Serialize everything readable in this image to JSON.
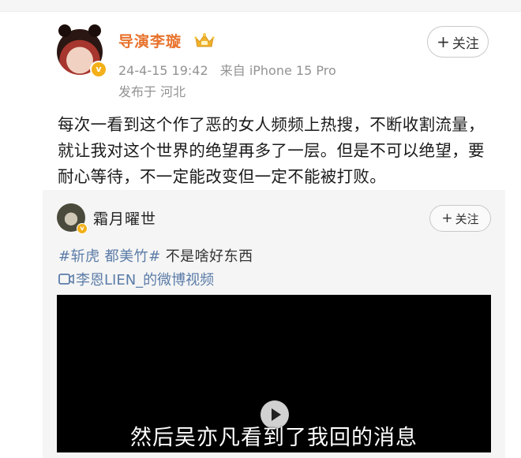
{
  "post": {
    "author_name": "导演李璇",
    "timestamp": "24-4-15 19:42",
    "source": "来自 iPhone 15 Pro",
    "location": "发布于 河北",
    "follow_label": "关注",
    "text": "每次一看到这个作了恶的女人频频上热搜，不断收割流量，就让我对这个世界的绝望再多了一层。但是不可以绝望，要耐心等待，不一定能改变但一定不能被打败。"
  },
  "repost": {
    "author_name": "霜月曜世",
    "follow_label": "关注",
    "tags": [
      "#斩虎",
      "都美竹#"
    ],
    "tag_plain": "不是啥好东西",
    "video_link": "李恩LIEN_的微博视频",
    "video_subtitle": "然后吴亦凡看到了我回的消息"
  },
  "icons": {
    "verified": "verified-badge-icon",
    "crown": "crown-icon",
    "video": "video-icon",
    "play": "play-icon",
    "plus": "plus-icon"
  },
  "colors": {
    "author_name": "#e8722b",
    "link": "#5b7ca8",
    "meta": "#939393",
    "verified_badge": "#f3b019"
  }
}
